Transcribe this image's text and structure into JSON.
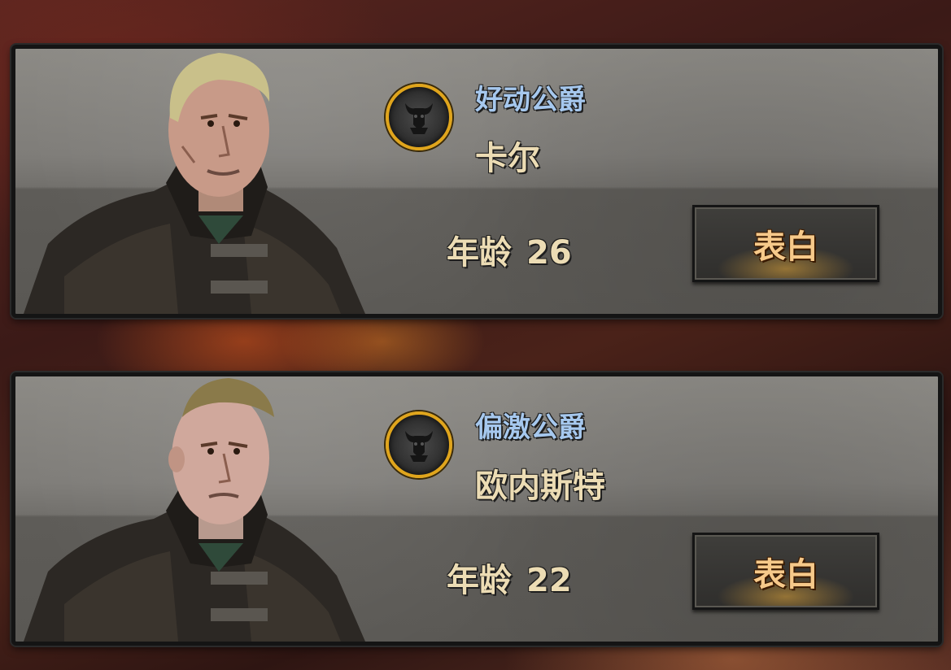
{
  "suitors": [
    {
      "title": "好动公爵",
      "name": "卡尔",
      "age_label": "年龄",
      "age": "26",
      "button_label": "表白",
      "hair_color": "#c9c08a",
      "emblem_icon": "bull-crest-icon"
    },
    {
      "title": "偏激公爵",
      "name": "欧内斯特",
      "age_label": "年龄",
      "age": "22",
      "button_label": "表白",
      "hair_color": "#8a7a4a",
      "emblem_icon": "bull-crest-icon"
    }
  ],
  "colors": {
    "title_blue": "#a6c8ee",
    "name_cream": "#ecdcb4",
    "button_text": "#f6c98a",
    "emblem_ring": "#e0a51c"
  }
}
